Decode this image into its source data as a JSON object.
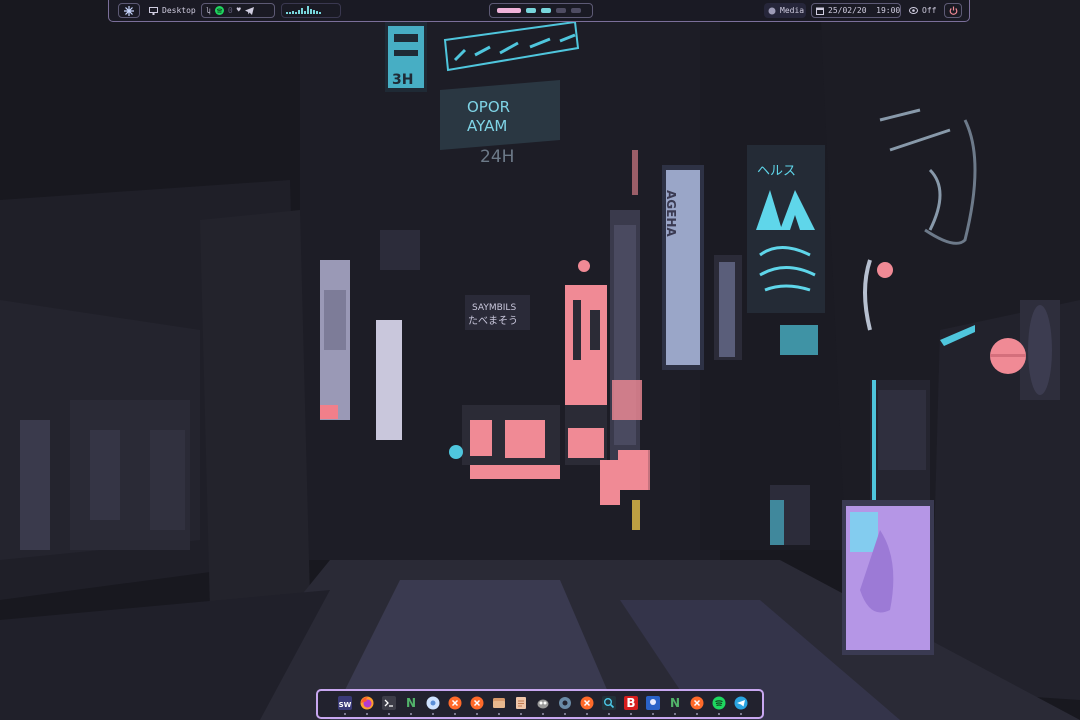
{
  "topbar": {
    "launcher_icon": "snowflake-icon",
    "workspace_label": "Desktop",
    "tray_count": "0",
    "media_label": "Media",
    "datetime": "25/02/20  19:00",
    "eye_status": "Off",
    "power_icon": "power-icon"
  },
  "workspaces": [
    {
      "state": "active"
    },
    {
      "state": "occupied"
    },
    {
      "state": "occupied"
    },
    {
      "state": "empty"
    },
    {
      "state": "empty"
    }
  ],
  "dock": {
    "apps": [
      {
        "name": "sw-app-icon",
        "text": "SW",
        "color": "#3a3a78"
      },
      {
        "name": "firefox-icon",
        "color": "#ff7a2c"
      },
      {
        "name": "terminal-icon",
        "color": "#2d2d36"
      },
      {
        "name": "neovim-icon",
        "text": "N",
        "color": "#52b36a"
      },
      {
        "name": "chromium-icon",
        "color": "#cfe3ff"
      },
      {
        "name": "close-app-icon",
        "color": "#ff6a2a"
      },
      {
        "name": "close-app-icon-2",
        "color": "#ff6a2a"
      },
      {
        "name": "files-icon",
        "color": "#d99a6c"
      },
      {
        "name": "document-icon",
        "color": "#efc5a8"
      },
      {
        "name": "gimp-icon",
        "color": "#9a9a9a"
      },
      {
        "name": "settings-icon",
        "color": "#6a8aa6"
      },
      {
        "name": "close-app-icon-3",
        "color": "#ff6a2a"
      },
      {
        "name": "search-app-icon",
        "color": "#4cc8e8"
      },
      {
        "name": "book-icon",
        "text": "B",
        "color": "#d61d1d"
      },
      {
        "name": "bluetooth-icon",
        "color": "#2a62c8"
      },
      {
        "name": "neovim-icon-2",
        "text": "N",
        "color": "#52b36a"
      },
      {
        "name": "close-app-icon-4",
        "color": "#ff6a2a"
      },
      {
        "name": "spotify-icon",
        "color": "#1ed760"
      },
      {
        "name": "telegram-icon",
        "color": "#2aa4e0"
      }
    ]
  },
  "colors": {
    "accent": "#c8a7f0",
    "cyan": "#6ee3f2",
    "pink": "#f08a95"
  },
  "wallpaper_signs": {
    "opor": "OPOR",
    "ayam": "AYAM",
    "hours": "24H",
    "helth": "ヘルス",
    "sanmbils": "SAYMBILS",
    "tabemasou": "たべまそう",
    "ageha": "AGEHA"
  }
}
